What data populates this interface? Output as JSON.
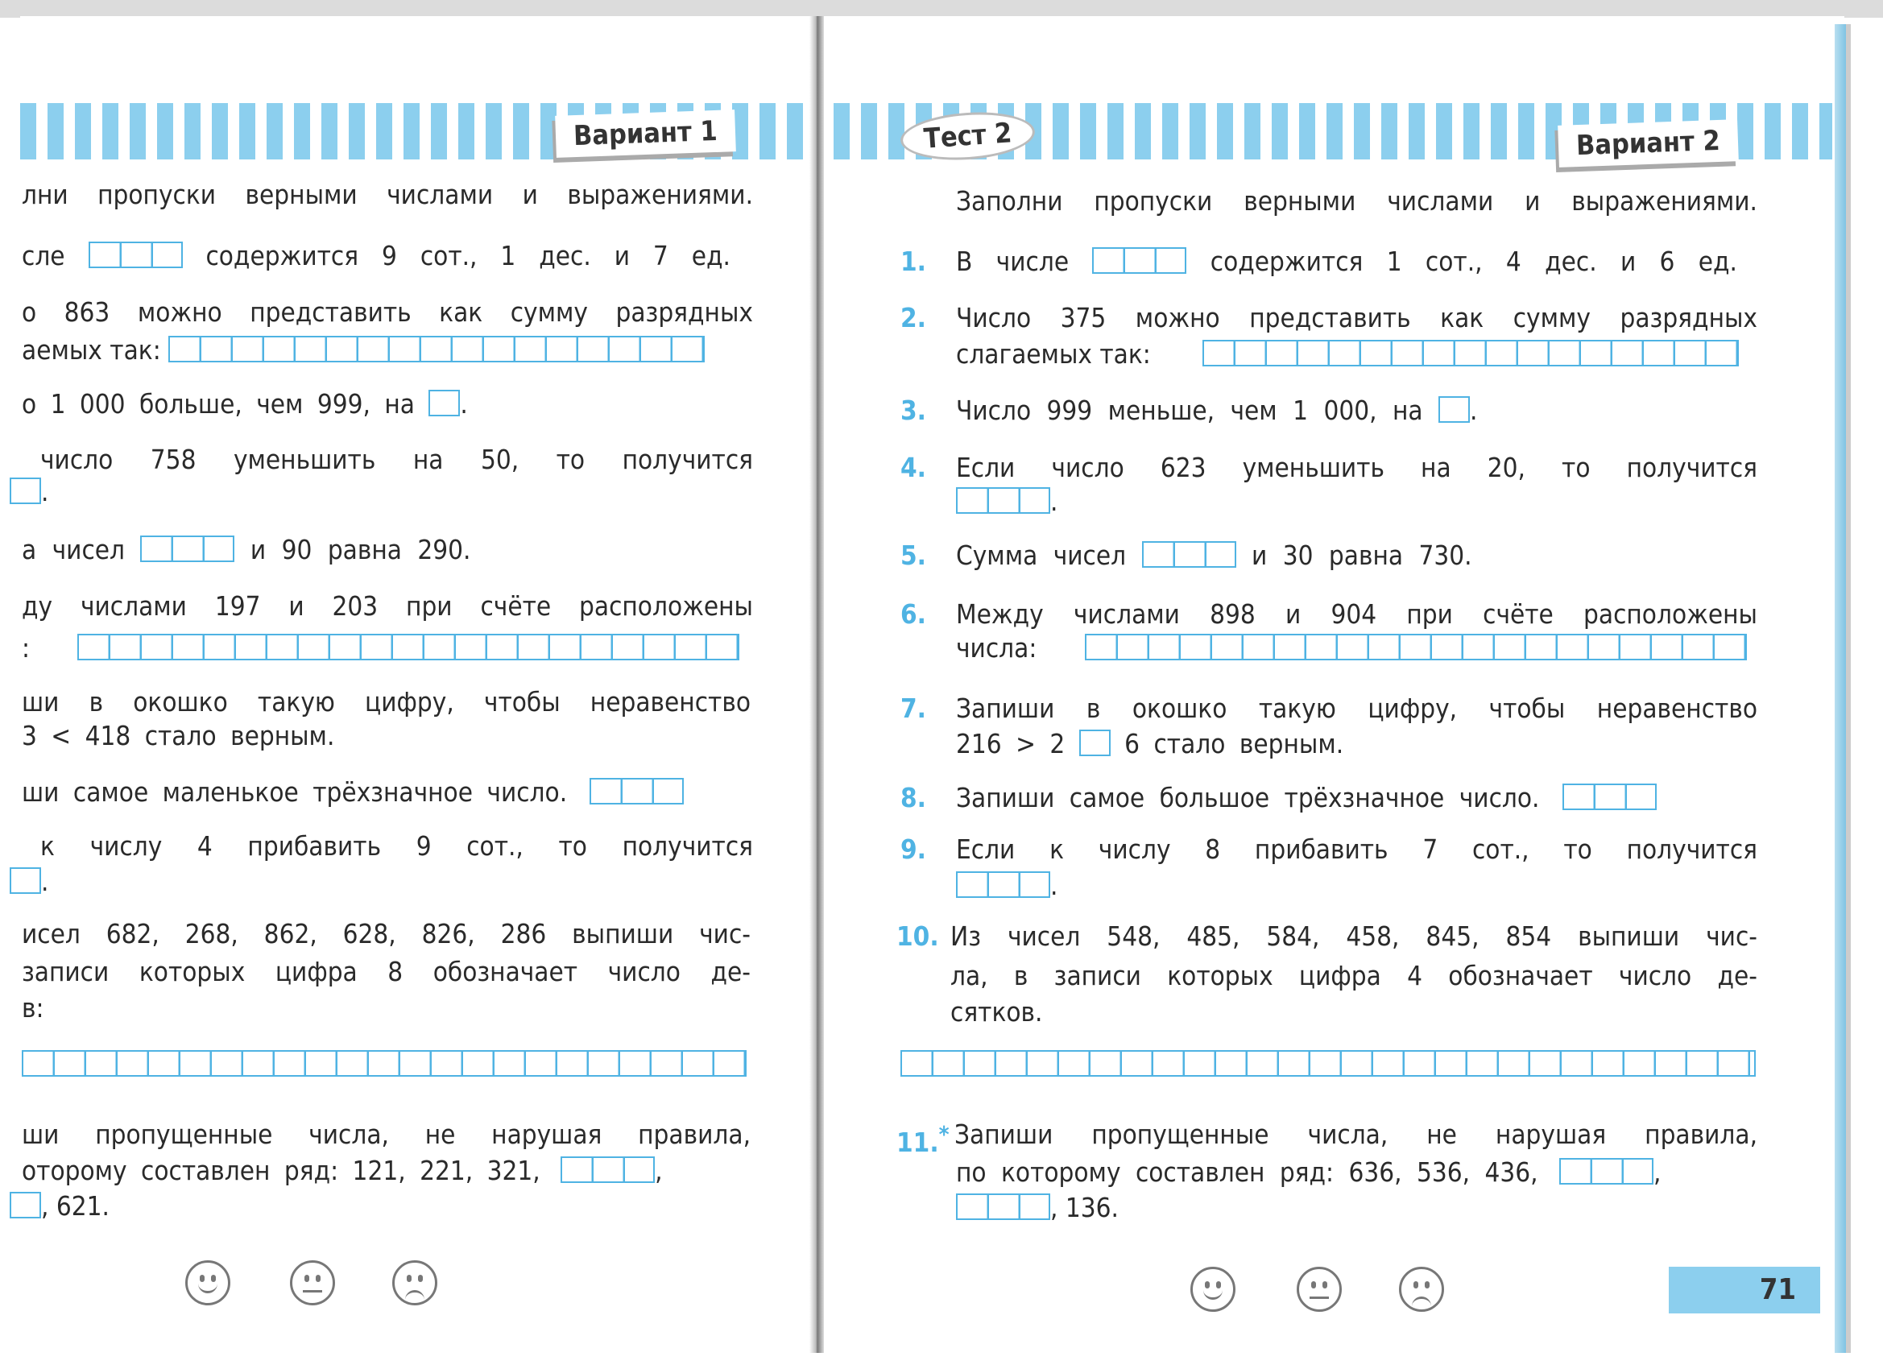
{
  "left": {
    "variant": "Вариант  1",
    "heading": "лни пропуски верными числами и выражениями.",
    "lines": [
      [
        "сле",
        "содержится 9 сот., 1 дес. и 7 ед."
      ],
      [
        "о 863 можно представить как сумму разрядных"
      ],
      [
        "аемых так:"
      ],
      [
        "о 1 000 больше, чем 999, на",
        "."
      ],
      [
        "число 758 уменьшить на 50, то получится"
      ],
      [
        "."
      ],
      [
        "а чисел",
        "и 90 равна 290."
      ],
      [
        "ду числами 197 и 203 при счёте расположены"
      ],
      [
        ":"
      ],
      [
        "ши в окошко такую цифру, чтобы неравенство"
      ],
      [
        "3 < 418 стало верным."
      ],
      [
        "ши самое маленькое трёхзначное число."
      ],
      [
        "к числу 4 прибавить 9 сот., то получится"
      ],
      [
        "."
      ],
      [
        "исел 682, 268, 862, 628, 826, 286 выпиши чис-"
      ],
      [
        "записи которых цифра 8 обозначает число де-"
      ],
      [
        "в:"
      ],
      [
        "ши пропущенные числа, не нарушая правила,"
      ],
      [
        "оторому составлен ряд: 121, 221, 321,",
        ","
      ],
      [
        ", 621."
      ]
    ]
  },
  "right": {
    "test": "Тест 2",
    "variant": "Вариант  2",
    "heading": "Заполни пропуски верными числами и выражениями.",
    "numbers": [
      "1.",
      "2.",
      "3.",
      "4.",
      "5.",
      "6.",
      "7.",
      "8.",
      "9.",
      "10.",
      "11."
    ],
    "star": "*",
    "lines": [
      [
        "В числе",
        "содержится 1 сот., 4 дес. и 6 ед."
      ],
      [
        "Число 375 можно представить как сумму разрядных"
      ],
      [
        "слагаемых так:"
      ],
      [
        "Число 999 меньше, чем 1 000, на",
        "."
      ],
      [
        "Если число 623 уменьшить на 20, то получится"
      ],
      [
        "."
      ],
      [
        "Сумма чисел",
        "и 30 равна 730."
      ],
      [
        "Между числами 898 и 904 при счёте расположены"
      ],
      [
        "числа:"
      ],
      [
        "Запиши в окошко такую цифру, чтобы неравенство"
      ],
      [
        "216 > 2",
        "6 стало верным."
      ],
      [
        "Запиши самое большое трёхзначное число."
      ],
      [
        "Если к числу 8 прибавить 7 сот., то получится"
      ],
      [
        "."
      ],
      [
        "Из чисел 548, 485, 584, 458, 845, 854 выпиши чис-"
      ],
      [
        "ла, в записи которых цифра 4 обозначает число де-"
      ],
      [
        "сятков."
      ],
      [
        "Запиши пропущенные числа, не нарушая правила,"
      ],
      [
        "по которому составлен ряд: 636, 536, 436,",
        ","
      ],
      [
        ", 136."
      ]
    ],
    "page_number": "71"
  },
  "colors": {
    "accent": "#4fb3e3",
    "stripe": "#8ccfee"
  },
  "icons": [
    "smiley-happy-icon",
    "smiley-neutral-icon",
    "smiley-sad-icon"
  ]
}
